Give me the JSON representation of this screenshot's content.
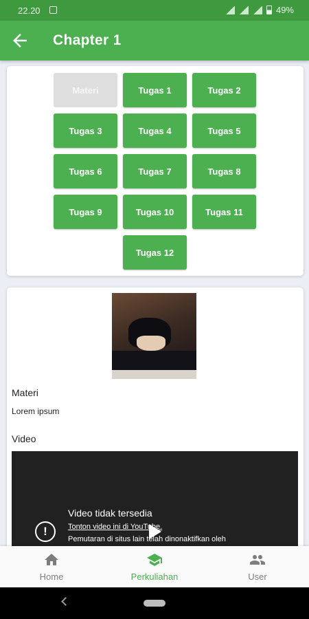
{
  "status_bar": {
    "time": "22.20",
    "battery": "49%"
  },
  "app_bar": {
    "title": "Chapter 1"
  },
  "tasks": {
    "buttons": [
      {
        "label": "Materi",
        "enabled": false
      },
      {
        "label": "Tugas 1",
        "enabled": true
      },
      {
        "label": "Tugas 2",
        "enabled": true
      },
      {
        "label": "Tugas 3",
        "enabled": true
      },
      {
        "label": "Tugas 4",
        "enabled": true
      },
      {
        "label": "Tugas 5",
        "enabled": true
      },
      {
        "label": "Tugas 6",
        "enabled": true
      },
      {
        "label": "Tugas 7",
        "enabled": true
      },
      {
        "label": "Tugas 8",
        "enabled": true
      },
      {
        "label": "Tugas 9",
        "enabled": true
      },
      {
        "label": "Tugas 10",
        "enabled": true
      },
      {
        "label": "Tugas 11",
        "enabled": true
      },
      {
        "label": "Tugas 12",
        "enabled": true
      }
    ]
  },
  "content": {
    "section_materi": "Materi",
    "materi_text": "Lorem ipsum",
    "section_video": "Video",
    "video": {
      "title": "Video tidak tersedia",
      "link": "Tonton video ini di YouTube.",
      "message": "Pemutaran di situs lain telah dinonaktifkan oleh"
    }
  },
  "bottom_nav": {
    "active": "Perkuliahan",
    "items": [
      {
        "label": "Home",
        "icon": "home-icon"
      },
      {
        "label": "Perkuliahan",
        "icon": "school-icon"
      },
      {
        "label": "User",
        "icon": "people-icon"
      }
    ]
  },
  "colors": {
    "primary": "#4caf50",
    "status_bar": "#3f9a3f",
    "disabled": "#dedede",
    "background": "#eceef5"
  }
}
